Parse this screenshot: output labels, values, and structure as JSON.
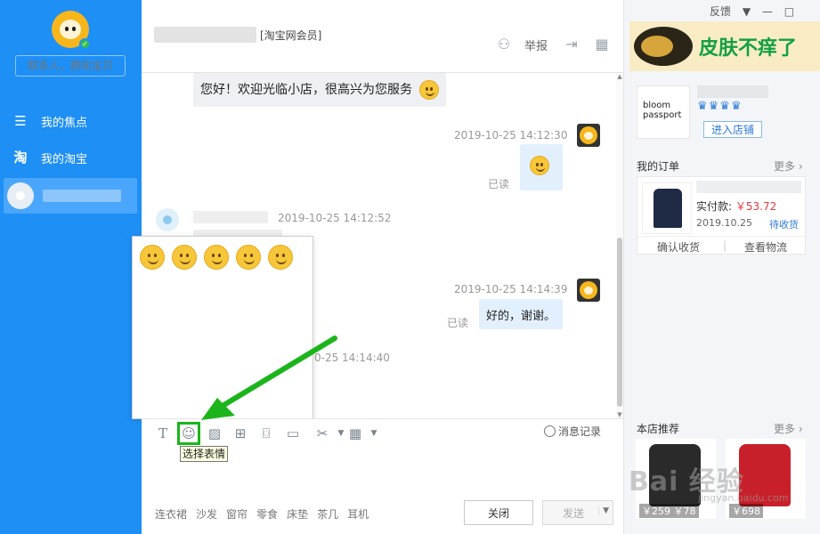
{
  "sidebar": {
    "search_placeholder": "联系人、群和宝贝",
    "nav": [
      {
        "label": "我的焦点",
        "icon": "focus-list-icon"
      },
      {
        "label": "我的淘宝",
        "icon": "taobao-icon"
      }
    ]
  },
  "header": {
    "member_tag": "[淘宝网会员]",
    "report_label": "举报"
  },
  "window_controls": {
    "feedback": "反馈",
    "menu": "▼",
    "minimize": "—",
    "maximize": "□",
    "close": "✕"
  },
  "messages": {
    "greeting": "您好！欢迎光临小店，很高兴为您服务",
    "ts1": "2019-10-25 14:12:30",
    "read1": "已读",
    "ts2": "2019-10-25 14:12:52",
    "ts3": "2019-10-25 14:14:39",
    "reply": "好的，谢谢。",
    "read2": "已读",
    "ts4_partial": "0-25 14:14:40"
  },
  "toolbar": {
    "tooltip": "选择表情",
    "history_label": "消息记录"
  },
  "quick_words": [
    "连衣裙",
    "沙发",
    "窗帘",
    "零食",
    "床垫",
    "茶几",
    "耳机"
  ],
  "buttons": {
    "close": "关闭",
    "send": "发送",
    "send_arrow": "▼"
  },
  "ad": {
    "text": "皮肤不痒了"
  },
  "shop": {
    "logo_text_1": "bloom",
    "logo_text_2": "passport",
    "crowns": "♛♛♛♛",
    "enter_label": "进入店铺"
  },
  "orders": {
    "title": "我的订单",
    "more": "更多 ›",
    "pay_label": "实付款: ",
    "pay_value": "￥53.72",
    "date": "2019.10.25",
    "status": "待收货",
    "confirm": "确认收货",
    "logistics": "查看物流"
  },
  "recommend": {
    "title": "本店推荐",
    "more": "更多 ›",
    "items": [
      {
        "price": "￥259 ￥78"
      },
      {
        "price": "￥698"
      }
    ]
  },
  "watermark": {
    "text": "Bai 经验",
    "sub": "jingyan.baidu.com"
  },
  "colors": {
    "sidebar_blue": "#1e8ff5",
    "highlight_green": "#1bb51b",
    "price_red": "#e4393c"
  }
}
